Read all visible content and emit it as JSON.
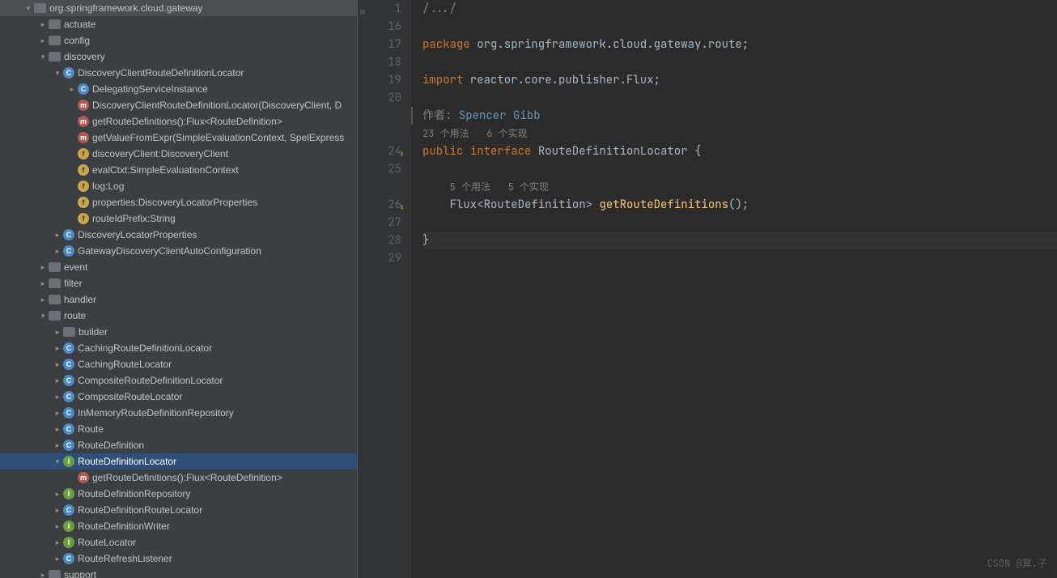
{
  "tree": [
    {
      "indent": 30,
      "arrow": "down",
      "icon": "folder",
      "label": "org.springframework.cloud.gateway"
    },
    {
      "indent": 48,
      "arrow": "right",
      "icon": "folder",
      "label": "actuate"
    },
    {
      "indent": 48,
      "arrow": "right",
      "icon": "folder",
      "label": "config"
    },
    {
      "indent": 48,
      "arrow": "down",
      "icon": "folder",
      "label": "discovery"
    },
    {
      "indent": 66,
      "arrow": "down",
      "icon": "c-blue",
      "iconText": "C",
      "label": "DiscoveryClientRouteDefinitionLocator"
    },
    {
      "indent": 84,
      "arrow": "right",
      "icon": "c-blue",
      "iconText": "C",
      "label": "DelegatingServiceInstance"
    },
    {
      "indent": 84,
      "arrow": "none",
      "icon": "m-red",
      "iconText": "m",
      "label": "DiscoveryClientRouteDefinitionLocator(DiscoveryClient, D"
    },
    {
      "indent": 84,
      "arrow": "none",
      "icon": "m-red",
      "iconText": "m",
      "label": "getRouteDefinitions():Flux<RouteDefinition>"
    },
    {
      "indent": 84,
      "arrow": "none",
      "icon": "m-red",
      "iconText": "m",
      "label": "getValueFromExpr(SimpleEvaluationContext, SpelExpress"
    },
    {
      "indent": 84,
      "arrow": "none",
      "icon": "f-yellow",
      "iconText": "f",
      "label": "discoveryClient:DiscoveryClient"
    },
    {
      "indent": 84,
      "arrow": "none",
      "icon": "f-yellow",
      "iconText": "f",
      "label": "evalCtxt:SimpleEvaluationContext"
    },
    {
      "indent": 84,
      "arrow": "none",
      "icon": "f-yellow",
      "iconText": "f",
      "label": "log:Log"
    },
    {
      "indent": 84,
      "arrow": "none",
      "icon": "f-yellow",
      "iconText": "f",
      "label": "properties:DiscoveryLocatorProperties"
    },
    {
      "indent": 84,
      "arrow": "none",
      "icon": "f-yellow",
      "iconText": "f",
      "label": "routeIdPrefix:String"
    },
    {
      "indent": 66,
      "arrow": "right",
      "icon": "c-blue",
      "iconText": "C",
      "label": "DiscoveryLocatorProperties"
    },
    {
      "indent": 66,
      "arrow": "right",
      "icon": "c-blue",
      "iconText": "C",
      "label": "GatewayDiscoveryClientAutoConfiguration"
    },
    {
      "indent": 48,
      "arrow": "right",
      "icon": "folder",
      "label": "event"
    },
    {
      "indent": 48,
      "arrow": "right",
      "icon": "folder",
      "label": "filter"
    },
    {
      "indent": 48,
      "arrow": "right",
      "icon": "folder",
      "label": "handler"
    },
    {
      "indent": 48,
      "arrow": "down",
      "icon": "folder",
      "label": "route"
    },
    {
      "indent": 66,
      "arrow": "right",
      "icon": "folder",
      "label": "builder"
    },
    {
      "indent": 66,
      "arrow": "right",
      "icon": "c-blue",
      "iconText": "C",
      "label": "CachingRouteDefinitionLocator"
    },
    {
      "indent": 66,
      "arrow": "right",
      "icon": "c-blue",
      "iconText": "C",
      "label": "CachingRouteLocator"
    },
    {
      "indent": 66,
      "arrow": "right",
      "icon": "c-blue",
      "iconText": "C",
      "label": "CompositeRouteDefinitionLocator"
    },
    {
      "indent": 66,
      "arrow": "right",
      "icon": "c-blue",
      "iconText": "C",
      "label": "CompositeRouteLocator"
    },
    {
      "indent": 66,
      "arrow": "right",
      "icon": "c-blue",
      "iconText": "C",
      "label": "InMemoryRouteDefinitionRepository"
    },
    {
      "indent": 66,
      "arrow": "right",
      "icon": "c-blue",
      "iconText": "C",
      "label": "Route"
    },
    {
      "indent": 66,
      "arrow": "right",
      "icon": "c-blue",
      "iconText": "C",
      "label": "RouteDefinition"
    },
    {
      "indent": 66,
      "arrow": "down",
      "icon": "c-green",
      "iconText": "I",
      "label": "RouteDefinitionLocator",
      "selected": true
    },
    {
      "indent": 84,
      "arrow": "none",
      "icon": "m-red",
      "iconText": "m",
      "label": "getRouteDefinitions():Flux<RouteDefinition>"
    },
    {
      "indent": 66,
      "arrow": "right",
      "icon": "c-green",
      "iconText": "I",
      "label": "RouteDefinitionRepository"
    },
    {
      "indent": 66,
      "arrow": "right",
      "icon": "c-blue",
      "iconText": "C",
      "label": "RouteDefinitionRouteLocator"
    },
    {
      "indent": 66,
      "arrow": "right",
      "icon": "c-green",
      "iconText": "I",
      "label": "RouteDefinitionWriter"
    },
    {
      "indent": 66,
      "arrow": "right",
      "icon": "c-green",
      "iconText": "I",
      "label": "RouteLocator"
    },
    {
      "indent": 66,
      "arrow": "right",
      "icon": "c-blue",
      "iconText": "C",
      "label": "RouteRefreshListener"
    },
    {
      "indent": 48,
      "arrow": "right",
      "icon": "folder",
      "label": "support"
    }
  ],
  "editor": {
    "foldText": "/.../",
    "lineNumbers": [
      "1",
      "16",
      "17",
      "18",
      "19",
      "20",
      "",
      "",
      "24",
      "25",
      "",
      "26",
      "27",
      "28",
      "29"
    ],
    "authorLabel": "作者: ",
    "authorName": "Spencer Gibb",
    "usage1": "23 个用法   6 个实现",
    "usage2": "5 个用法   5 个实现",
    "code": {
      "package_kw": "package",
      "package_val": " org.springframework.cloud.gateway.route;",
      "import_kw": "import",
      "import_val": " reactor.core.publisher.Flux;",
      "public_kw": "public ",
      "interface_kw": "interface ",
      "ifname": "RouteDefinitionLocator ",
      "open": "{",
      "flux": "Flux",
      "lt": "<",
      "rd": "RouteDefinition",
      "gt": "> ",
      "method": "getRouteDefinitions",
      "parens": "();",
      "close": "}"
    }
  },
  "watermark": "CSDN @算.子"
}
